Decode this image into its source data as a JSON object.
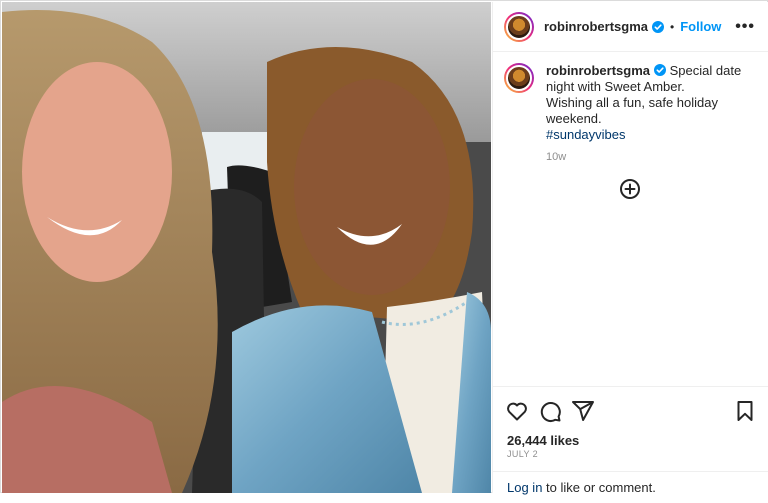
{
  "post": {
    "username": "robinrobertsgma",
    "dot": "•",
    "follow_label": "Follow",
    "more_label": "•••",
    "caption_line1": "Special date night with Sweet Amber.",
    "caption_line2": "Wishing all a fun, safe holiday weekend.",
    "hashtag": "#sundayvibes",
    "time_ago": "10w",
    "likes": "26,444 likes",
    "date": "JULY 2",
    "login_link": "Log in",
    "login_suffix": " to like or comment."
  },
  "icons": [
    "verified-badge-icon",
    "add-comment-icon",
    "heart-icon",
    "comment-icon",
    "share-icon",
    "bookmark-icon",
    "more-options-icon"
  ],
  "colors": {
    "accent": "#0095f6",
    "link": "#00376b",
    "muted": "#8e8e8e",
    "text": "#262626"
  }
}
